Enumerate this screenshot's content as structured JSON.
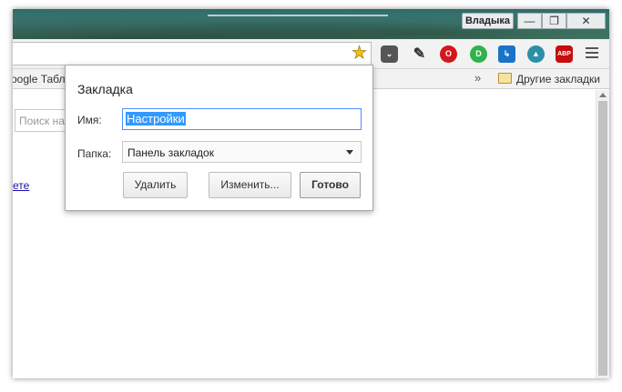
{
  "titlebar": {
    "profile_name": "Владыка",
    "minimize": "—",
    "restore": "❐",
    "close": "✕"
  },
  "toolbar": {
    "bookmark_star": "★",
    "extensions": [
      {
        "icon": "pocket-icon",
        "glyph": "⌄"
      },
      {
        "icon": "evernote-icon",
        "glyph": "✎"
      },
      {
        "icon": "opera-turbo-icon",
        "glyph": "O"
      },
      {
        "icon": "ghostery-icon",
        "glyph": "D"
      },
      {
        "icon": "save-icon",
        "glyph": "↳"
      },
      {
        "icon": "speed-dial-icon",
        "glyph": "▲"
      },
      {
        "icon": "adblock-plus-icon",
        "glyph": "ABP"
      }
    ]
  },
  "bookmarks_bar": {
    "left_item": "oogle Табл",
    "more": "»",
    "other_bookmarks": "Другие закладки"
  },
  "page": {
    "search_placeholder": "Поиск на",
    "link_fragment": "ете"
  },
  "dialog": {
    "title": "Закладка",
    "name_label": "Имя:",
    "name_value": "Настройки",
    "folder_label": "Папка:",
    "folder_value": "Панель закладок",
    "delete_button": "Удалить",
    "edit_button": "Изменить...",
    "done_button": "Готово"
  },
  "colors": {
    "accent_focus": "#4d90fe",
    "selection": "#3399ff",
    "star": "#f4c20d"
  }
}
